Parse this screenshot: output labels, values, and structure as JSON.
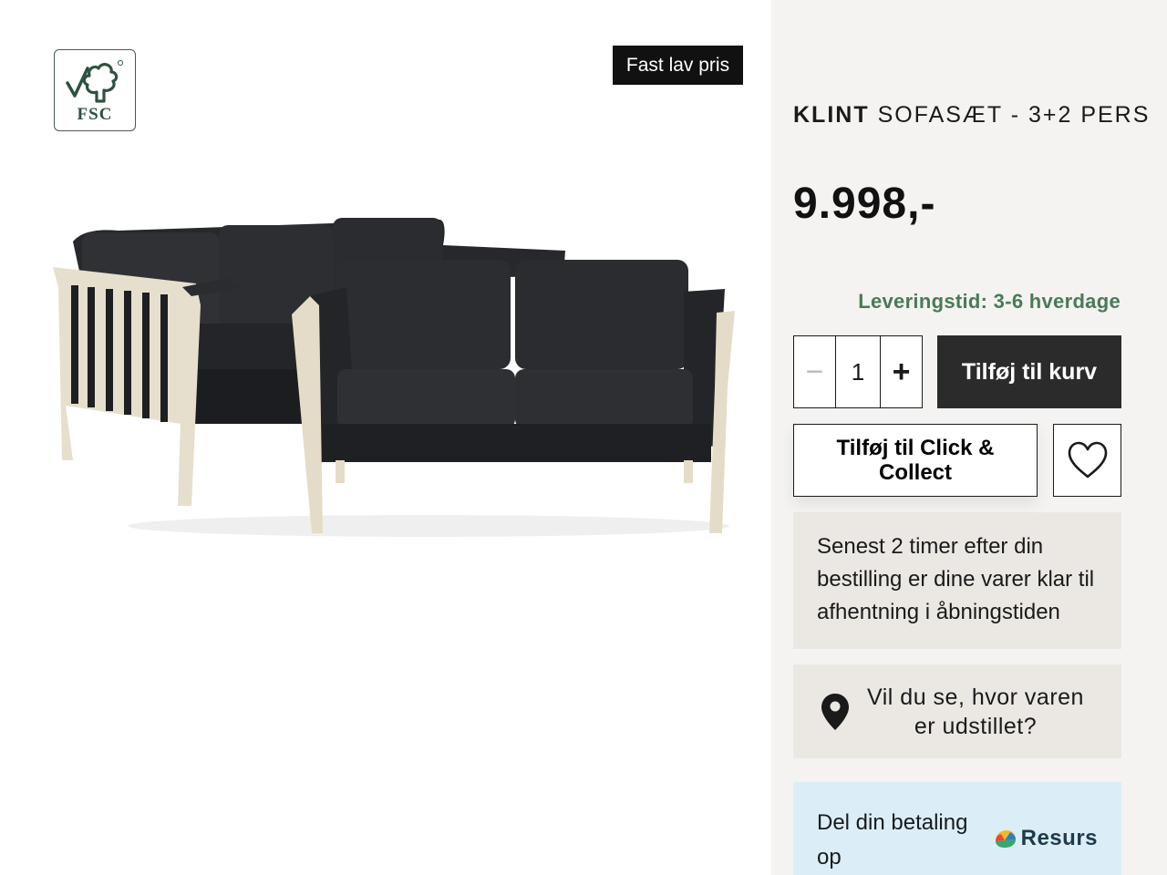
{
  "image_area": {
    "certification_badge": "FSC",
    "promo_tag": "Fast lav pris"
  },
  "product": {
    "brand": "KLINT",
    "name": "SOFASÆT - 3+2 PERS",
    "price": "9.998,-",
    "delivery": "Leveringstid: 3-6 hverdage"
  },
  "quantity": {
    "value": "1",
    "minus": "−",
    "plus": "+"
  },
  "buttons": {
    "add_to_cart": "Tilføj til kurv",
    "click_collect": "Tilføj til Click & Collect",
    "wishlist_icon": "heart-icon"
  },
  "pickup_info": "Senest 2 timer efter din bestilling er dine varer klar til afhentning i åbningstiden",
  "showroom": {
    "icon": "location-pin-icon",
    "text": "Vil du se, hvor varen er udstillet?"
  },
  "financing": {
    "text": "Del din betaling op",
    "provider": "Resurs"
  },
  "colors": {
    "panel_bg": "#f4f3f1",
    "info_box_bg": "#ebe8e4",
    "financing_bg": "#dbeef7",
    "delivery_green": "#4a7a58",
    "button_dark": "#2b2b2b"
  }
}
